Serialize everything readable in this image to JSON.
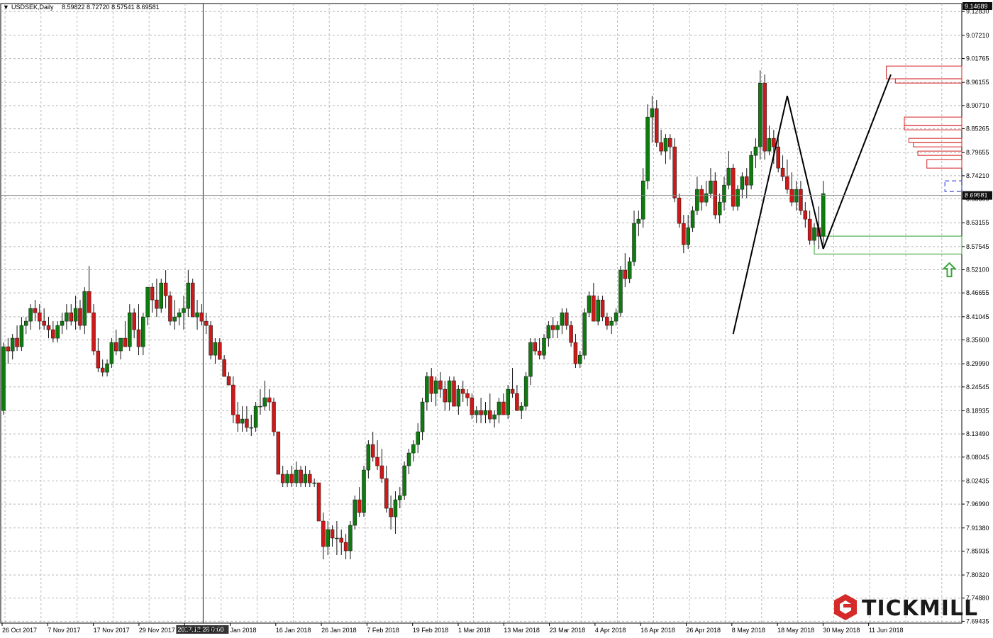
{
  "header": {
    "symbol": "USDSEK,Daily",
    "ohlc": "8.59822 8.72720 8.57541 8.69581",
    "menu_glyph": "▼"
  },
  "logo": {
    "text": "TICKMILL"
  },
  "crosshair_label": "2017.12.28 0:00",
  "price_marker": "8.69581",
  "top_marker": "9.14689",
  "colors": {
    "bull": "#0f7a0f",
    "bear": "#cc1a1a",
    "grid": "#b8b8b8",
    "resistance": "#d42020",
    "support": "#2e9e2e",
    "dash": "#1a2bd4",
    "arrow": "#3aa43a",
    "logo_red": "#d42a2a"
  },
  "chart_data": {
    "type": "candlestick",
    "symbol": "USDSEK",
    "timeframe": "Daily",
    "y_ticks": [
      "9.12830",
      "9.07210",
      "9.01765",
      "8.96155",
      "8.90710",
      "8.85265",
      "8.79655",
      "8.74210",
      "8.68800",
      "8.63155",
      "8.57545",
      "8.52100",
      "8.46655",
      "8.41045",
      "8.35600",
      "8.29990",
      "8.24545",
      "8.18935",
      "8.13490",
      "8.08045",
      "8.02435",
      "7.96990",
      "7.91380",
      "7.85935",
      "7.80320",
      "7.74880",
      "7.69435"
    ],
    "x_ticks": [
      "26 Oct 2017",
      "7 Nov 2017",
      "17 Nov 2017",
      "29 Nov 2017",
      "11 Dec 2017",
      "Jan 2018",
      "16 Jan 2018",
      "26 Jan 2018",
      "7 Feb 2018",
      "19 Feb 2018",
      "1 Mar 2018",
      "13 Mar 2018",
      "23 Mar 2018",
      "4 Apr 2018",
      "16 Apr 2018",
      "26 Apr 2018",
      "8 May 2018",
      "18 May 2018",
      "30 May 2018",
      "11 Jun 2018"
    ],
    "ylim": [
      7.69,
      9.147
    ],
    "current_price": 8.69581,
    "crosshair_index": 44,
    "candles": [
      [
        8.19,
        8.35,
        8.18,
        8.34
      ],
      [
        8.34,
        8.36,
        8.3,
        8.33
      ],
      [
        8.33,
        8.37,
        8.31,
        8.36
      ],
      [
        8.36,
        8.39,
        8.33,
        8.34
      ],
      [
        8.34,
        8.41,
        8.33,
        8.39
      ],
      [
        8.39,
        8.41,
        8.37,
        8.4
      ],
      [
        8.4,
        8.44,
        8.38,
        8.43
      ],
      [
        8.43,
        8.45,
        8.4,
        8.42
      ],
      [
        8.42,
        8.44,
        8.38,
        8.4
      ],
      [
        8.4,
        8.43,
        8.38,
        8.39
      ],
      [
        8.39,
        8.41,
        8.36,
        8.38
      ],
      [
        8.38,
        8.4,
        8.35,
        8.36
      ],
      [
        8.36,
        8.4,
        8.35,
        8.39
      ],
      [
        8.39,
        8.42,
        8.37,
        8.4
      ],
      [
        8.4,
        8.44,
        8.38,
        8.42
      ],
      [
        8.42,
        8.44,
        8.39,
        8.4
      ],
      [
        8.4,
        8.46,
        8.38,
        8.43
      ],
      [
        8.43,
        8.45,
        8.38,
        8.39
      ],
      [
        8.39,
        8.48,
        8.37,
        8.47
      ],
      [
        8.47,
        8.53,
        8.42,
        8.42
      ],
      [
        8.42,
        8.44,
        8.32,
        8.33
      ],
      [
        8.33,
        8.36,
        8.28,
        8.29
      ],
      [
        8.29,
        8.31,
        8.27,
        8.28
      ],
      [
        8.28,
        8.31,
        8.27,
        8.3
      ],
      [
        8.3,
        8.36,
        8.29,
        8.35
      ],
      [
        8.35,
        8.38,
        8.32,
        8.33
      ],
      [
        8.33,
        8.36,
        8.31,
        8.36
      ],
      [
        8.36,
        8.4,
        8.34,
        8.34
      ],
      [
        8.34,
        8.44,
        8.33,
        8.42
      ],
      [
        8.42,
        8.43,
        8.36,
        8.38
      ],
      [
        8.38,
        8.44,
        8.32,
        8.34
      ],
      [
        8.34,
        8.42,
        8.32,
        8.41
      ],
      [
        8.41,
        8.46,
        8.39,
        8.48
      ],
      [
        8.48,
        8.49,
        8.42,
        8.45
      ],
      [
        8.45,
        8.5,
        8.41,
        8.43
      ],
      [
        8.43,
        8.5,
        8.42,
        8.49
      ],
      [
        8.49,
        8.52,
        8.43,
        8.46
      ],
      [
        8.46,
        8.47,
        8.39,
        8.4
      ],
      [
        8.4,
        8.45,
        8.38,
        8.41
      ],
      [
        8.41,
        8.43,
        8.39,
        8.42
      ],
      [
        8.42,
        8.46,
        8.38,
        8.43
      ],
      [
        8.43,
        8.52,
        8.41,
        8.49
      ],
      [
        8.49,
        8.5,
        8.41,
        8.41
      ],
      [
        8.41,
        8.45,
        8.38,
        8.42
      ],
      [
        8.42,
        8.44,
        8.39,
        8.4
      ],
      [
        8.4,
        8.42,
        8.37,
        8.39
      ],
      [
        8.39,
        8.4,
        8.31,
        8.32
      ],
      [
        8.32,
        8.36,
        8.3,
        8.35
      ],
      [
        8.35,
        8.36,
        8.31,
        8.31
      ],
      [
        8.31,
        8.32,
        8.27,
        8.27
      ],
      [
        8.27,
        8.28,
        8.25,
        8.25
      ],
      [
        8.25,
        8.27,
        8.16,
        8.18
      ],
      [
        8.18,
        8.21,
        8.14,
        8.16
      ],
      [
        8.16,
        8.2,
        8.14,
        8.17
      ],
      [
        8.17,
        8.2,
        8.14,
        8.15
      ],
      [
        8.15,
        8.18,
        8.13,
        8.15
      ],
      [
        8.15,
        8.21,
        8.14,
        8.2
      ],
      [
        8.2,
        8.24,
        8.18,
        8.2
      ],
      [
        8.2,
        8.26,
        8.19,
        8.22
      ],
      [
        8.22,
        8.24,
        8.19,
        8.21
      ],
      [
        8.21,
        8.22,
        8.13,
        8.14
      ],
      [
        8.14,
        8.14,
        8.04,
        8.04
      ],
      [
        8.04,
        8.06,
        8.01,
        8.02
      ],
      [
        8.02,
        8.05,
        8.01,
        8.04
      ],
      [
        8.04,
        8.06,
        8.01,
        8.02
      ],
      [
        8.02,
        8.07,
        8.01,
        8.05
      ],
      [
        8.05,
        8.06,
        8.01,
        8.02
      ],
      [
        8.02,
        8.06,
        8.01,
        8.04
      ],
      [
        8.04,
        8.05,
        8.01,
        8.02
      ],
      [
        8.02,
        8.03,
        8.01,
        8.02
      ],
      [
        8.02,
        8.02,
        7.93,
        7.93
      ],
      [
        7.93,
        7.95,
        7.84,
        7.87
      ],
      [
        7.87,
        7.93,
        7.85,
        7.91
      ],
      [
        7.91,
        7.92,
        7.87,
        7.89
      ],
      [
        7.89,
        7.93,
        7.85,
        7.89
      ],
      [
        7.89,
        7.91,
        7.85,
        7.88
      ],
      [
        7.88,
        7.9,
        7.84,
        7.86
      ],
      [
        7.86,
        7.93,
        7.84,
        7.92
      ],
      [
        7.92,
        7.99,
        7.91,
        7.98
      ],
      [
        7.98,
        8.01,
        7.94,
        7.95
      ],
      [
        7.95,
        8.06,
        7.94,
        8.05
      ],
      [
        8.05,
        8.12,
        8.03,
        8.11
      ],
      [
        8.11,
        8.14,
        8.07,
        8.08
      ],
      [
        8.08,
        8.12,
        8.05,
        8.06
      ],
      [
        8.06,
        8.1,
        8.02,
        8.03
      ],
      [
        8.03,
        8.06,
        7.95,
        7.96
      ],
      [
        7.96,
        7.99,
        7.91,
        7.94
      ],
      [
        7.94,
        8.0,
        7.9,
        7.98
      ],
      [
        7.98,
        8.01,
        7.96,
        7.99
      ],
      [
        7.99,
        8.07,
        7.98,
        8.06
      ],
      [
        8.06,
        8.1,
        8.04,
        8.09
      ],
      [
        8.09,
        8.12,
        8.07,
        8.11
      ],
      [
        8.11,
        8.16,
        8.09,
        8.14
      ],
      [
        8.14,
        8.22,
        8.12,
        8.21
      ],
      [
        8.21,
        8.28,
        8.19,
        8.27
      ],
      [
        8.27,
        8.29,
        8.21,
        8.23
      ],
      [
        8.23,
        8.27,
        8.2,
        8.26
      ],
      [
        8.26,
        8.28,
        8.22,
        8.24
      ],
      [
        8.24,
        8.26,
        8.19,
        8.21
      ],
      [
        8.21,
        8.27,
        8.19,
        8.26
      ],
      [
        8.26,
        8.27,
        8.2,
        8.2
      ],
      [
        8.2,
        8.25,
        8.18,
        8.24
      ],
      [
        8.24,
        8.26,
        8.21,
        8.23
      ],
      [
        8.23,
        8.24,
        8.2,
        8.22
      ],
      [
        8.22,
        8.23,
        8.17,
        8.18
      ],
      [
        8.18,
        8.2,
        8.16,
        8.19
      ],
      [
        8.19,
        8.22,
        8.16,
        8.18
      ],
      [
        8.18,
        8.21,
        8.16,
        8.19
      ],
      [
        8.19,
        8.23,
        8.16,
        8.17
      ],
      [
        8.17,
        8.19,
        8.15,
        8.18
      ],
      [
        8.18,
        8.22,
        8.16,
        8.21
      ],
      [
        8.21,
        8.23,
        8.18,
        8.18
      ],
      [
        8.18,
        8.25,
        8.17,
        8.24
      ],
      [
        8.24,
        8.29,
        8.22,
        8.23
      ],
      [
        8.23,
        8.25,
        8.19,
        8.19
      ],
      [
        8.19,
        8.21,
        8.17,
        8.2
      ],
      [
        8.2,
        8.28,
        8.19,
        8.27
      ],
      [
        8.27,
        8.36,
        8.25,
        8.35
      ],
      [
        8.35,
        8.36,
        8.32,
        8.33
      ],
      [
        8.33,
        8.36,
        8.31,
        8.32
      ],
      [
        8.32,
        8.37,
        8.31,
        8.36
      ],
      [
        8.36,
        8.4,
        8.34,
        8.39
      ],
      [
        8.39,
        8.41,
        8.36,
        8.38
      ],
      [
        8.38,
        8.4,
        8.36,
        8.39
      ],
      [
        8.39,
        8.43,
        8.37,
        8.42
      ],
      [
        8.42,
        8.43,
        8.38,
        8.39
      ],
      [
        8.39,
        8.4,
        8.34,
        8.35
      ],
      [
        8.35,
        8.37,
        8.29,
        8.3
      ],
      [
        8.3,
        8.33,
        8.29,
        8.32
      ],
      [
        8.32,
        8.43,
        8.31,
        8.42
      ],
      [
        8.42,
        8.47,
        8.41,
        8.46
      ],
      [
        8.46,
        8.49,
        8.4,
        8.4
      ],
      [
        8.4,
        8.46,
        8.39,
        8.45
      ],
      [
        8.45,
        8.46,
        8.4,
        8.41
      ],
      [
        8.41,
        8.42,
        8.38,
        8.39
      ],
      [
        8.39,
        8.41,
        8.37,
        8.4
      ],
      [
        8.4,
        8.43,
        8.39,
        8.42
      ],
      [
        8.42,
        8.53,
        8.41,
        8.52
      ],
      [
        8.52,
        8.56,
        8.48,
        8.5
      ],
      [
        8.5,
        8.55,
        8.49,
        8.54
      ],
      [
        8.54,
        8.66,
        8.53,
        8.63
      ],
      [
        8.63,
        8.66,
        8.6,
        8.64
      ],
      [
        8.64,
        8.76,
        8.62,
        8.73
      ],
      [
        8.73,
        8.91,
        8.71,
        8.88
      ],
      [
        8.88,
        8.93,
        8.82,
        8.9
      ],
      [
        8.9,
        8.92,
        8.81,
        8.82
      ],
      [
        8.82,
        8.85,
        8.79,
        8.8
      ],
      [
        8.8,
        8.84,
        8.77,
        8.83
      ],
      [
        8.83,
        8.84,
        8.78,
        8.81
      ],
      [
        8.81,
        8.83,
        8.68,
        8.69
      ],
      [
        8.69,
        8.7,
        8.62,
        8.63
      ],
      [
        8.63,
        8.65,
        8.56,
        8.58
      ],
      [
        8.58,
        8.65,
        8.57,
        8.62
      ],
      [
        8.62,
        8.67,
        8.61,
        8.66
      ],
      [
        8.66,
        8.74,
        8.65,
        8.71
      ],
      [
        8.71,
        8.72,
        8.66,
        8.68
      ],
      [
        8.68,
        8.73,
        8.67,
        8.7
      ],
      [
        8.7,
        8.76,
        8.69,
        8.73
      ],
      [
        8.73,
        8.75,
        8.64,
        8.65
      ],
      [
        8.65,
        8.7,
        8.63,
        8.68
      ],
      [
        8.68,
        8.74,
        8.66,
        8.72
      ],
      [
        8.72,
        8.8,
        8.71,
        8.76
      ],
      [
        8.76,
        8.77,
        8.66,
        8.67
      ],
      [
        8.67,
        8.72,
        8.66,
        8.71
      ],
      [
        8.71,
        8.75,
        8.69,
        8.74
      ],
      [
        8.74,
        8.76,
        8.69,
        8.72
      ],
      [
        8.72,
        8.8,
        8.71,
        8.79
      ],
      [
        8.79,
        8.83,
        8.76,
        8.81
      ],
      [
        8.81,
        8.99,
        8.78,
        8.96
      ],
      [
        8.96,
        8.98,
        8.78,
        8.8
      ],
      [
        8.8,
        8.86,
        8.79,
        8.83
      ],
      [
        8.83,
        8.85,
        8.77,
        8.81
      ],
      [
        8.81,
        8.84,
        8.75,
        8.76
      ],
      [
        8.76,
        8.79,
        8.73,
        8.74
      ],
      [
        8.74,
        8.78,
        8.7,
        8.71
      ],
      [
        8.71,
        8.75,
        8.67,
        8.68
      ],
      [
        8.68,
        8.73,
        8.66,
        8.71
      ],
      [
        8.71,
        8.73,
        8.65,
        8.66
      ],
      [
        8.66,
        8.68,
        8.62,
        8.64
      ],
      [
        8.64,
        8.66,
        8.58,
        8.59
      ],
      [
        8.59,
        8.63,
        8.58,
        8.62
      ],
      [
        8.62,
        8.67,
        8.57,
        8.6
      ],
      [
        8.6,
        8.73,
        8.58,
        8.7
      ]
    ],
    "pattern_lines": [
      {
        "from_index": 162,
        "from_price": 8.37,
        "to_index": 174,
        "to_price": 8.93
      },
      {
        "from_index": 174,
        "from_price": 8.93,
        "to_index": 182,
        "to_price": 8.57
      },
      {
        "from_index": 182,
        "from_price": 8.57,
        "to_index": 197,
        "to_price": 8.98
      }
    ],
    "resistance_zones": [
      {
        "start_index": 196,
        "top": 9.0,
        "bottom": 8.97
      },
      {
        "start_index": 198,
        "top": 8.97,
        "bottom": 8.96
      },
      {
        "start_index": 200,
        "top": 8.88,
        "bottom": 8.86
      },
      {
        "start_index": 200,
        "top": 8.86,
        "bottom": 8.85
      },
      {
        "start_index": 201,
        "top": 8.83,
        "bottom": 8.82
      },
      {
        "start_index": 202,
        "top": 8.82,
        "bottom": 8.81
      },
      {
        "start_index": 203,
        "top": 8.8,
        "bottom": 8.79
      },
      {
        "start_index": 205,
        "top": 8.78,
        "bottom": 8.76
      }
    ],
    "support_zone": {
      "start_index": 180,
      "top": 8.6,
      "bottom": 8.558
    },
    "dashed_zone": {
      "start_index": 209,
      "top": 8.73,
      "bottom": 8.705
    },
    "up_arrow": {
      "index": 210,
      "price": 8.52
    }
  }
}
